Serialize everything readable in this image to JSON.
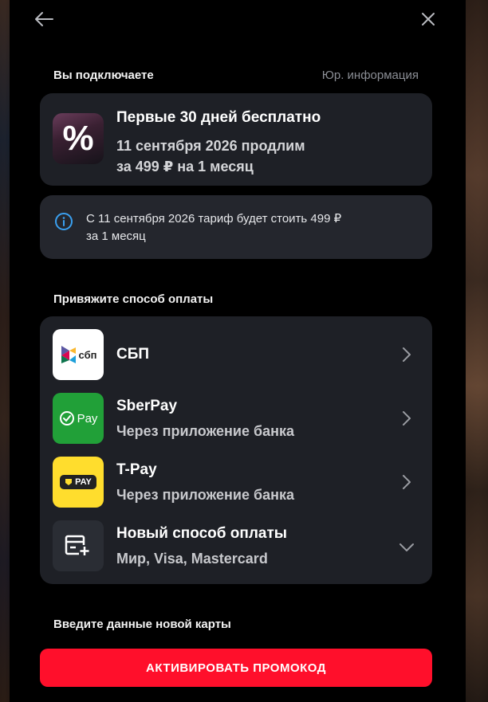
{
  "header": {
    "back_icon": "arrow-left-icon",
    "close_icon": "close-icon"
  },
  "subscription": {
    "section_title": "Вы подключаете",
    "legal_link": "Юр. информация",
    "offer_badge": "%",
    "offer_title": "Первые 30 дней бесплатно",
    "offer_line1": "11 сентября 2026 продлим",
    "offer_line2": "за 499 ₽ на 1 месяц"
  },
  "notice": {
    "icon": "info-icon",
    "text_line1": "С 11 сентября 2026 тариф будет стоить 499 ₽",
    "text_line2": "за 1 месяц"
  },
  "payment": {
    "section_title": "Привяжите способ оплаты",
    "methods": [
      {
        "name": "СБП",
        "logo_text": "сбп",
        "icon": "sbp-logo",
        "subtitle": "",
        "chevron": "chevron-right-icon"
      },
      {
        "name": "SberPay",
        "logo_text": "Pay",
        "icon": "sberpay-logo",
        "subtitle": "Через приложение банка",
        "chevron": "chevron-right-icon"
      },
      {
        "name": "T-Pay",
        "logo_text": "PAY",
        "icon": "tpay-logo",
        "subtitle": "Через приложение банка",
        "chevron": "chevron-right-icon"
      },
      {
        "name": "Новый способ оплаты",
        "icon": "new-card-icon",
        "subtitle": "Мир, Visa, Mastercard",
        "chevron": "chevron-down-icon"
      }
    ]
  },
  "card_entry": {
    "section_title": "Введите данные новой карты"
  },
  "cta": {
    "label": "АКТИВИРОВАТЬ ПРОМОКОД"
  },
  "colors": {
    "accent": "#ff0f2b",
    "card_bg": "#1e2026",
    "sberpay_green": "#21a038",
    "tpay_yellow": "#ffdd2d"
  }
}
